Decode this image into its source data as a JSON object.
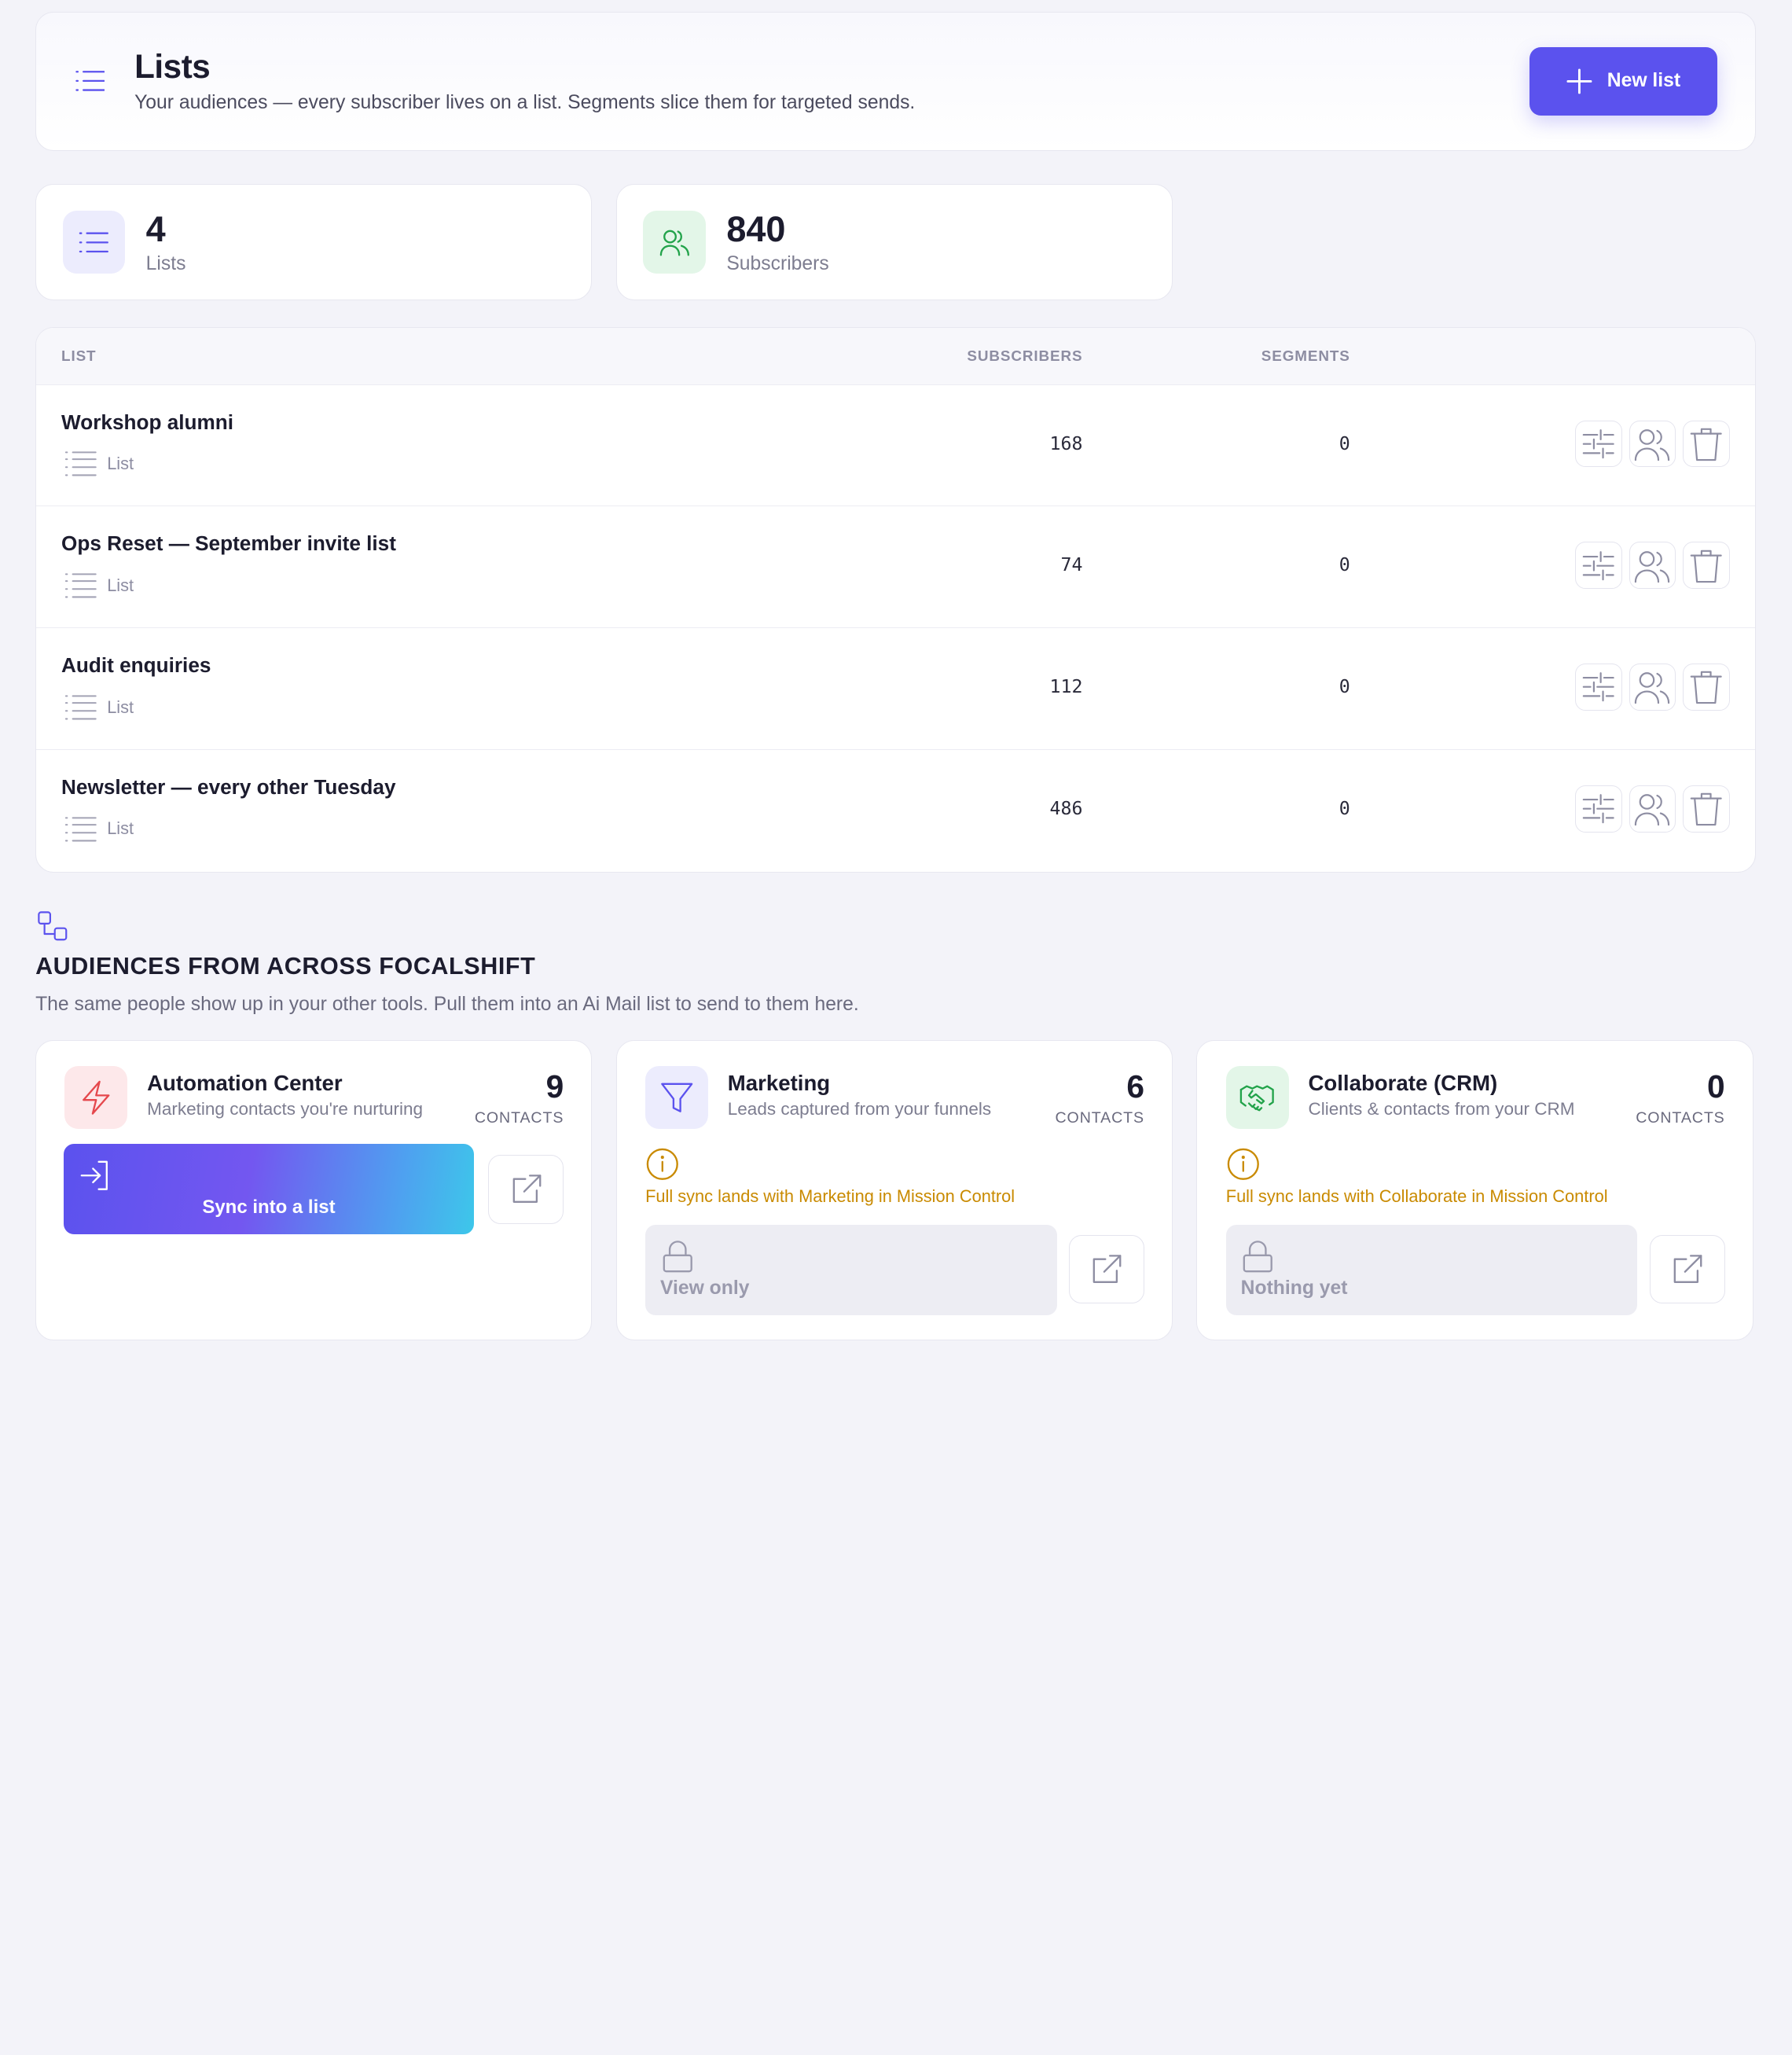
{
  "header": {
    "title": "Lists",
    "subtitle": "Your audiences — every subscriber lives on a list. Segments slice them for targeted sends.",
    "new_list_label": "New list"
  },
  "stats": [
    {
      "value": "4",
      "label": "Lists",
      "icon": "list-icon",
      "color": "#5b52ee"
    },
    {
      "value": "840",
      "label": "Subscribers",
      "icon": "users-icon",
      "color": "#22a34a"
    }
  ],
  "table": {
    "columns": [
      "LIST",
      "SUBSCRIBERS",
      "SEGMENTS"
    ],
    "rows": [
      {
        "name": "Workshop alumni",
        "type": "List",
        "subscribers": "168",
        "segments": "0"
      },
      {
        "name": "Ops Reset — September invite list",
        "type": "List",
        "subscribers": "74",
        "segments": "0"
      },
      {
        "name": "Audit enquiries",
        "type": "List",
        "subscribers": "112",
        "segments": "0"
      },
      {
        "name": "Newsletter — every other Tuesday",
        "type": "List",
        "subscribers": "486",
        "segments": "0"
      }
    ]
  },
  "audiences": {
    "title": "AUDIENCES FROM ACROSS FOCALSHIFT",
    "subtitle": "The same people show up in your other tools. Pull them into an Ai Mail list to send to them here.",
    "cards": [
      {
        "title": "Automation Center",
        "subtitle": "Marketing contacts you're nurturing",
        "count": "9",
        "count_label": "CONTACTS",
        "icon": "lightning-icon",
        "color": "#e5484d",
        "action_label": "Sync into a list"
      },
      {
        "title": "Marketing",
        "subtitle": "Leads captured from your funnels",
        "count": "6",
        "count_label": "CONTACTS",
        "icon": "funnel-icon",
        "color": "#5b52ee",
        "note": "Full sync lands with Marketing in Mission Control",
        "locked_label": "View only"
      },
      {
        "title": "Collaborate (CRM)",
        "subtitle": "Clients & contacts from your CRM",
        "count": "0",
        "count_label": "CONTACTS",
        "icon": "handshake-icon",
        "color": "#22a34a",
        "note": "Full sync lands with Collaborate in Mission Control",
        "locked_label": "Nothing yet"
      }
    ]
  }
}
